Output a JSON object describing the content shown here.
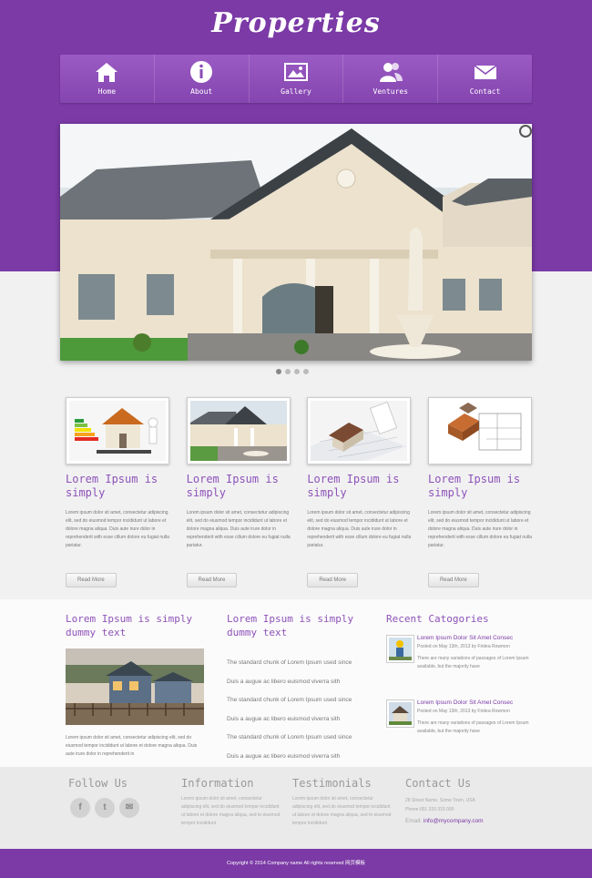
{
  "site": {
    "logo": "Properties"
  },
  "nav": [
    {
      "label": "Home",
      "icon": "home-icon"
    },
    {
      "label": "About",
      "icon": "info-icon"
    },
    {
      "label": "Gallery",
      "icon": "image-icon"
    },
    {
      "label": "Ventures",
      "icon": "users-icon"
    },
    {
      "label": "Contact",
      "icon": "mail-icon"
    }
  ],
  "features": [
    {
      "title": "Lorem Ipsum is simply",
      "text": "Lorem ipsum dolor sit amet, consectetur adipiscing elit, sed do eiusmod tempor incididunt ut labore et dolore magna aliqua. Duis aute irure dolor in reprehenderit with esse cillum dolore eu fugiat nulla pariatur.",
      "button": "Read More"
    },
    {
      "title": "Lorem Ipsum is simply",
      "text": "Lorem ipsum dolor sit amet, consectetur adipiscing elit, sed do eiusmod tempor incididunt ut labore et dolore magna aliqua. Duis aute irure dolor in reprehenderit with esse cillum dolore eu fugiat nulla pariatur.",
      "button": "Read More"
    },
    {
      "title": "Lorem Ipsum is simply",
      "text": "Lorem ipsum dolor sit amet, consectetur adipiscing elit, sed do eiusmod tempor incididunt ut labore et dolore magna aliqua. Duis aute irure dolor in reprehenderit with esse cillum dolore eu fugiat nulla pariatur.",
      "button": "Read More"
    },
    {
      "title": "Lorem Ipsum is simply",
      "text": "Lorem ipsum dolor sit amet, consectetur adipiscing elit, sed do eiusmod tempor incididunt ut labore et dolore magna aliqua. Duis aute irure dolor in reprehenderit with esse cillum dolore eu fugiat nulla pariatur.",
      "button": "Read More"
    }
  ],
  "middle": {
    "left": {
      "title": "Lorem Ipsum is simply dummy text",
      "text": "Lorem ipsum dolor sit amet, consectetur adipiscing elit, sed do eiusmod tempor incididunt ut labore et dolore magna aliqua. Duis aute irure dolor in reprehenderit in"
    },
    "center": {
      "title": "Lorem Ipsum is simply dummy text",
      "links": [
        "The standard chunk of Lorem Ipsum used since",
        "Duis a augue ac libero euismod viverra sith",
        "The standard chunk of Lorem Ipsum used since",
        "Duis a augue ac libero euismod viverra sith",
        "The standard chunk of Lorem Ipsum used since",
        "Duis a augue ac libero euismod viverra sith"
      ]
    },
    "right": {
      "title": "Recent Catogories",
      "posts": [
        {
          "title": "Lorem Ipsum Dolor Sit Amet Consec",
          "meta": "Posted on May 13th, 2013 by Fridea Rowmon",
          "text": "There are many variations of passages of Lorem Ipsum available, but the majority have"
        },
        {
          "title": "Lorem Ipsum Dolor Sit Amet Consec",
          "meta": "Posted on May 13th, 2013 by Fridea Rowmon",
          "text": "There are many variations of passages of Lorem Ipsum available, but the majority have"
        }
      ]
    }
  },
  "footer": {
    "follow": {
      "title": "Follow Us",
      "icons": [
        "facebook-icon",
        "twitter-icon",
        "mail-icon"
      ]
    },
    "information": {
      "title": "Information",
      "text": "Lorem ipsum dolor sit amet, consectetur adipiscing elit, sed do eiusmod tempor incididunt ut labore et dolore magna aliqua, sed to eiusmod tempor incididunt"
    },
    "testimonials": {
      "title": "Testimonials",
      "text": "Lorem ipsum dolor sit amet, consectetur adipiscing elit, sed do eiusmod tempor incididunt ut labore et dolore magna aliqua, sed to eiusmod tempor incididunt"
    },
    "contact": {
      "title": "Contact Us",
      "address": "28 Street Name, Some Town, USA",
      "phone": "Phone:001 333 333 000",
      "email_label": "Email:",
      "email": "info@mycompany.com"
    }
  },
  "copyright": "Copyright © 2014 Company name All rights reserved 网页模板",
  "colors": {
    "brand": "#7b3aa6",
    "heading": "#8e52b8"
  }
}
